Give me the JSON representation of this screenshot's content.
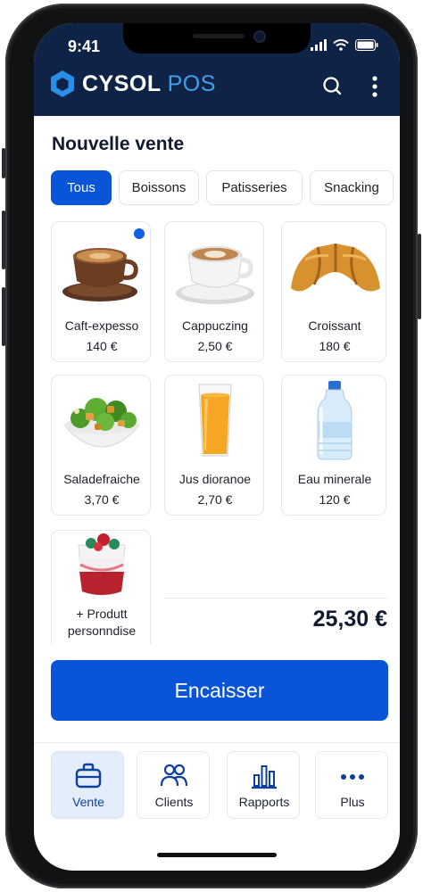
{
  "status_bar": {
    "time": "9:41"
  },
  "header": {
    "brand_primary": "CYSOL",
    "brand_secondary": "POS"
  },
  "page": {
    "title": "Nouvelle vente"
  },
  "tabs": [
    {
      "label": "Tous",
      "active": true
    },
    {
      "label": "Boissons",
      "active": false
    },
    {
      "label": "Patisseries",
      "active": false
    },
    {
      "label": "Snacking",
      "active": false
    }
  ],
  "products": [
    {
      "name": "Caft-expesso",
      "price": "140 €",
      "icon": "espresso-cup-image",
      "selected": true
    },
    {
      "name": "Cappuczing",
      "price": "2,50 €",
      "icon": "cappuccino-cup-image"
    },
    {
      "name": "Croissant",
      "price": "180 €",
      "icon": "croissant-image"
    },
    {
      "name": "Saladefraiche",
      "price": "3,70 €",
      "icon": "salad-bowl-image"
    },
    {
      "name": "Jus dioranoe",
      "price": "2,70 €",
      "icon": "orange-juice-image"
    },
    {
      "name": "Eau minerale",
      "price": "120 €",
      "icon": "water-bottle-image"
    }
  ],
  "custom_product": {
    "line1": "+ Produtt",
    "line2": "personndise",
    "icon": "parfait-glass-image"
  },
  "cart": {
    "total": "25,30 €"
  },
  "actions": {
    "checkout": "Encaisser"
  },
  "bottom_nav": [
    {
      "label": "Vente",
      "icon": "briefcase-icon",
      "active": true
    },
    {
      "label": "Clients",
      "icon": "users-icon",
      "active": false
    },
    {
      "label": "Rapports",
      "icon": "bar-chart-icon",
      "active": false
    },
    {
      "label": "Plus",
      "icon": "more-dots-icon",
      "active": false
    }
  ],
  "colors": {
    "brand_dark": "#0e2346",
    "accent": "#0a54d8",
    "logo_accent": "#3fa0f0"
  }
}
